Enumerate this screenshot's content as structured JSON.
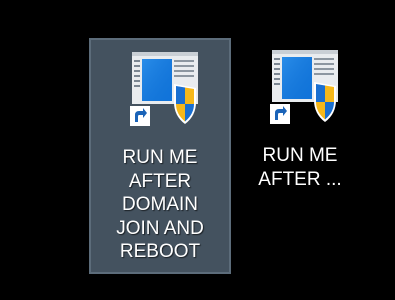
{
  "desktop": {
    "background": "#000000",
    "icons": [
      {
        "label": "RUN ME AFTER DOMAIN JOIN AND REBOOT",
        "icon": "windows-shortcut-with-uac-shield-icon",
        "selected": true,
        "selection_color": "#44525f"
      },
      {
        "label": "RUN ME AFTER ...",
        "icon": "windows-shortcut-with-uac-shield-icon",
        "selected": false
      }
    ]
  }
}
